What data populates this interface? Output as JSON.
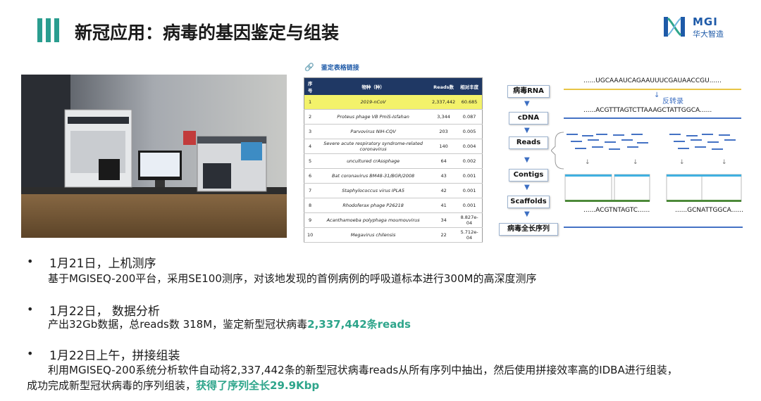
{
  "header": {
    "title": "新冠应用：病毒的基因鉴定与组装",
    "logo_text": "MGI",
    "logo_sub": "华大智造"
  },
  "colors": {
    "accent": "#2a9d8f",
    "highlight_green": "#2ea58b",
    "table_header": "#1f3864",
    "row_highlight": "#f3f26a",
    "flow_blue": "#4472c4"
  },
  "table": {
    "link_label": "鉴定表格链接",
    "columns": [
      "序号",
      "物种（种）",
      "Reads数",
      "相对丰度"
    ],
    "rows": [
      [
        "1",
        "2019-nCoV",
        "2,337,442",
        "60.685"
      ],
      [
        "2",
        "Proteus phage VB PmiS-Isfahan",
        "3,344",
        "0.087"
      ],
      [
        "3",
        "Parvovirus NIH-CQV",
        "203",
        "0.005"
      ],
      [
        "4",
        "Severe acute respiratory syndrome-related coronavirus",
        "140",
        "0.004"
      ],
      [
        "5",
        "uncultured crAssphage",
        "64",
        "0.002"
      ],
      [
        "6",
        "Bat coronavirus BM48-31/BGR/2008",
        "43",
        "0.001"
      ],
      [
        "7",
        "Staphylococcus virus IPLA5",
        "42",
        "0.001"
      ],
      [
        "8",
        "Rhodoferax phage P26218",
        "41",
        "0.001"
      ],
      [
        "9",
        "Acanthamoeba polyphaga moumouvirus",
        "34",
        "8.827e-04"
      ],
      [
        "10",
        "Megavirus chilensis",
        "22",
        "5.712e-04"
      ]
    ]
  },
  "flow": {
    "steps": [
      "病毒RNA",
      "cDNA",
      "Reads",
      "Contigs",
      "Scaffolds",
      "病毒全长序列"
    ],
    "rna_seq": "......UGCAAAUCAGAAUUUCGAUAACCGU......",
    "reverse_label": "反转录",
    "cdna_seq": "......ACGTTTAGTCTTAAAGCTATTGGCA......",
    "contig_left_seq": "......ACGTNTAGTC......",
    "contig_right_seq": "......GCNATTGGCA......"
  },
  "bullets": [
    {
      "marker": "•",
      "head": "1月21日，上机测序",
      "text": "基于MGISEQ-200平台，采用SE100测序，对该地发现的首例病例的呼吸道标本进行300M的高深度测序"
    },
    {
      "marker": "•",
      "head": "1月22日， 数据分析",
      "text": "产出32Gb数据，总reads数 318M，鉴定新型冠状病毒",
      "highlight": "2,337,442条reads"
    },
    {
      "marker": "•",
      "head": "1月22日上午，拼接组装",
      "text1": "利用MGISEQ-200系统分析软件自动将2,337,442条的新型冠状病毒reads从所有序列中抽出，然后使用拼接效率高的IDBA进行组装，",
      "text2": "成功完成新型冠状病毒的序列组装，",
      "highlight": "获得了序列全长29.9Kbp"
    }
  ]
}
